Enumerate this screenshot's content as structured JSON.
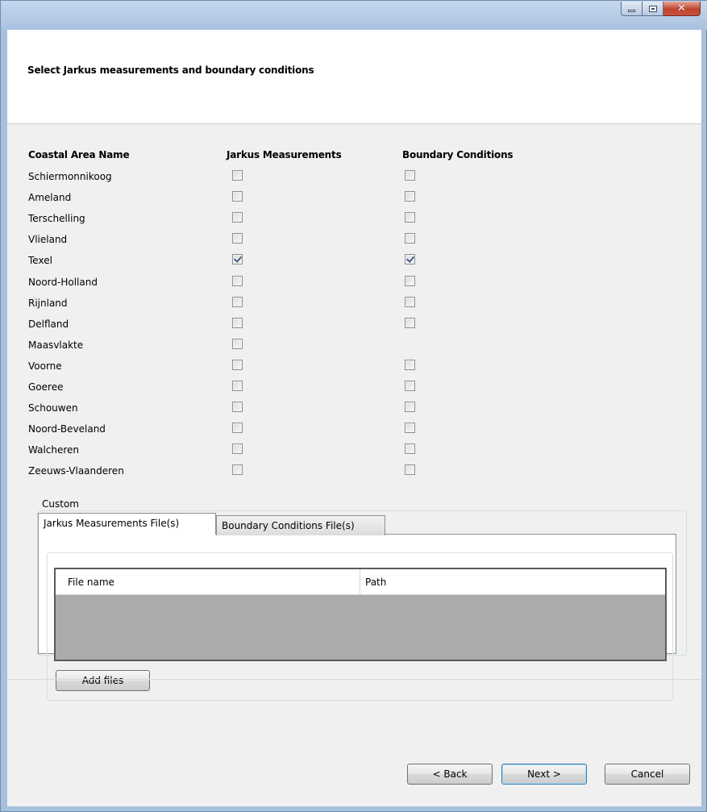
{
  "window": {
    "title": "",
    "caption_buttons": {
      "minimize": "minimize-icon",
      "maximize": "maximize-icon",
      "close": "✕"
    }
  },
  "header": {
    "title": "Select Jarkus measurements and boundary conditions"
  },
  "columns": {
    "area_name": "Coastal Area Name",
    "jarkus": "Jarkus Measurements",
    "boundary": "Boundary Conditions"
  },
  "areas": [
    {
      "name": "Schiermonnikoog",
      "jarkus": false,
      "boundary": false
    },
    {
      "name": "Ameland",
      "jarkus": false,
      "boundary": false
    },
    {
      "name": "Terschelling",
      "jarkus": false,
      "boundary": false
    },
    {
      "name": "Vlieland",
      "jarkus": false,
      "boundary": false
    },
    {
      "name": "Texel",
      "jarkus": true,
      "boundary": true
    },
    {
      "name": "Noord-Holland",
      "jarkus": false,
      "boundary": false
    },
    {
      "name": "Rijnland",
      "jarkus": false,
      "boundary": false
    },
    {
      "name": "Delfland",
      "jarkus": false,
      "boundary": false
    },
    {
      "name": "Maasvlakte",
      "jarkus": false,
      "boundary": null
    },
    {
      "name": "Voorne",
      "jarkus": false,
      "boundary": false
    },
    {
      "name": "Goeree",
      "jarkus": false,
      "boundary": false
    },
    {
      "name": "Schouwen",
      "jarkus": false,
      "boundary": false
    },
    {
      "name": "Noord-Beveland",
      "jarkus": false,
      "boundary": false
    },
    {
      "name": "Walcheren",
      "jarkus": false,
      "boundary": false
    },
    {
      "name": "Zeeuws-Vlaanderen",
      "jarkus": false,
      "boundary": false
    }
  ],
  "custom": {
    "legend": "Custom",
    "tabs": [
      {
        "label": "Jarkus Measurements File(s)",
        "active": true
      },
      {
        "label": "Boundary Conditions File(s)",
        "active": false
      }
    ],
    "grid_columns": [
      "File name",
      "Path"
    ],
    "add_files_label": "Add files"
  },
  "footer": {
    "back_label": "< Back",
    "next_label": "Next >",
    "cancel_label": "Cancel"
  }
}
